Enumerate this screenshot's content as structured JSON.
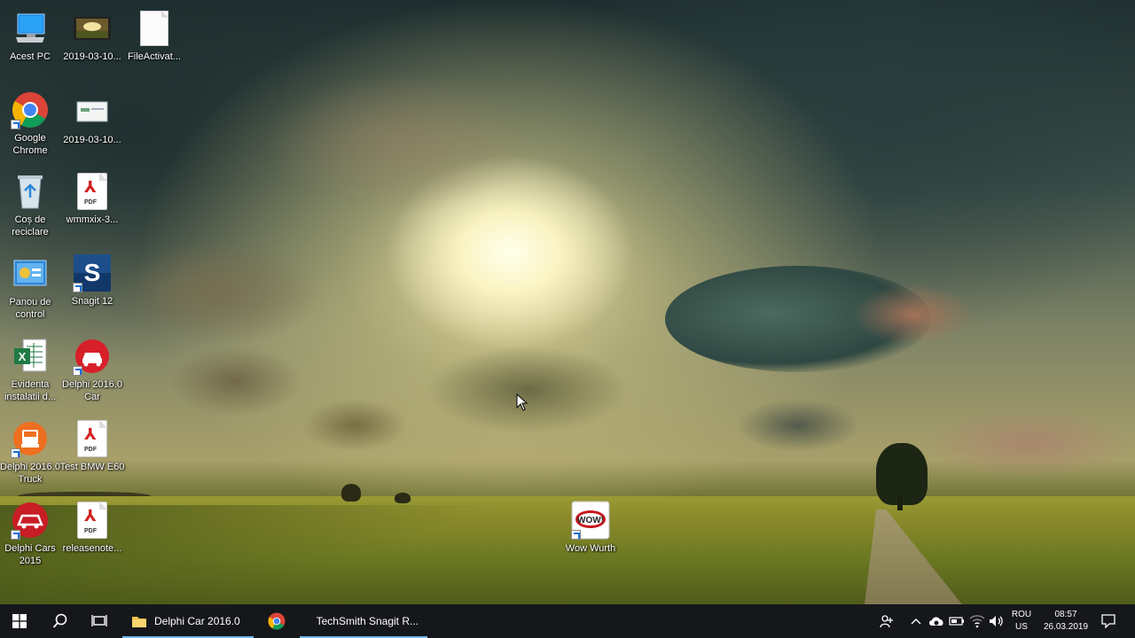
{
  "desktop": {
    "icons": [
      {
        "label": "Acest PC"
      },
      {
        "label": "2019-03-10..."
      },
      {
        "label": "FileActivat..."
      },
      {
        "label": "Google Chrome"
      },
      {
        "label": "2019-03-10..."
      },
      {
        "label": "Coș de reciclare"
      },
      {
        "label": "wmmxix-3..."
      },
      {
        "label": "Panou de control"
      },
      {
        "label": "Snagit 12"
      },
      {
        "label": "Evidenta instalatii d..."
      },
      {
        "label": "Delphi 2016.0 Car"
      },
      {
        "label": "Delphi 2016.0 Truck"
      },
      {
        "label": "Test BMW E60"
      },
      {
        "label": "Delphi Cars 2015"
      },
      {
        "label": "releasenote..."
      },
      {
        "label": "Wow Wurth"
      }
    ],
    "pdf_mark_text": "PDF",
    "wow_logo_text": "WOW!"
  },
  "taskbar": {
    "apps": [
      {
        "label": "Delphi Car 2016.0"
      },
      {
        "label": ""
      },
      {
        "label": "TechSmith Snagit R..."
      }
    ],
    "tray": {
      "language_top": "ROU",
      "language_bottom": "US",
      "time": "08:57",
      "date": "26.03.2019"
    }
  },
  "colors": {
    "taskbar_bg": "#15171b",
    "active_underline": "#76b9ed",
    "chrome_red": "#db4437",
    "chrome_yellow": "#f4b400",
    "chrome_green": "#0f9d58",
    "chrome_blue": "#4285f4"
  }
}
